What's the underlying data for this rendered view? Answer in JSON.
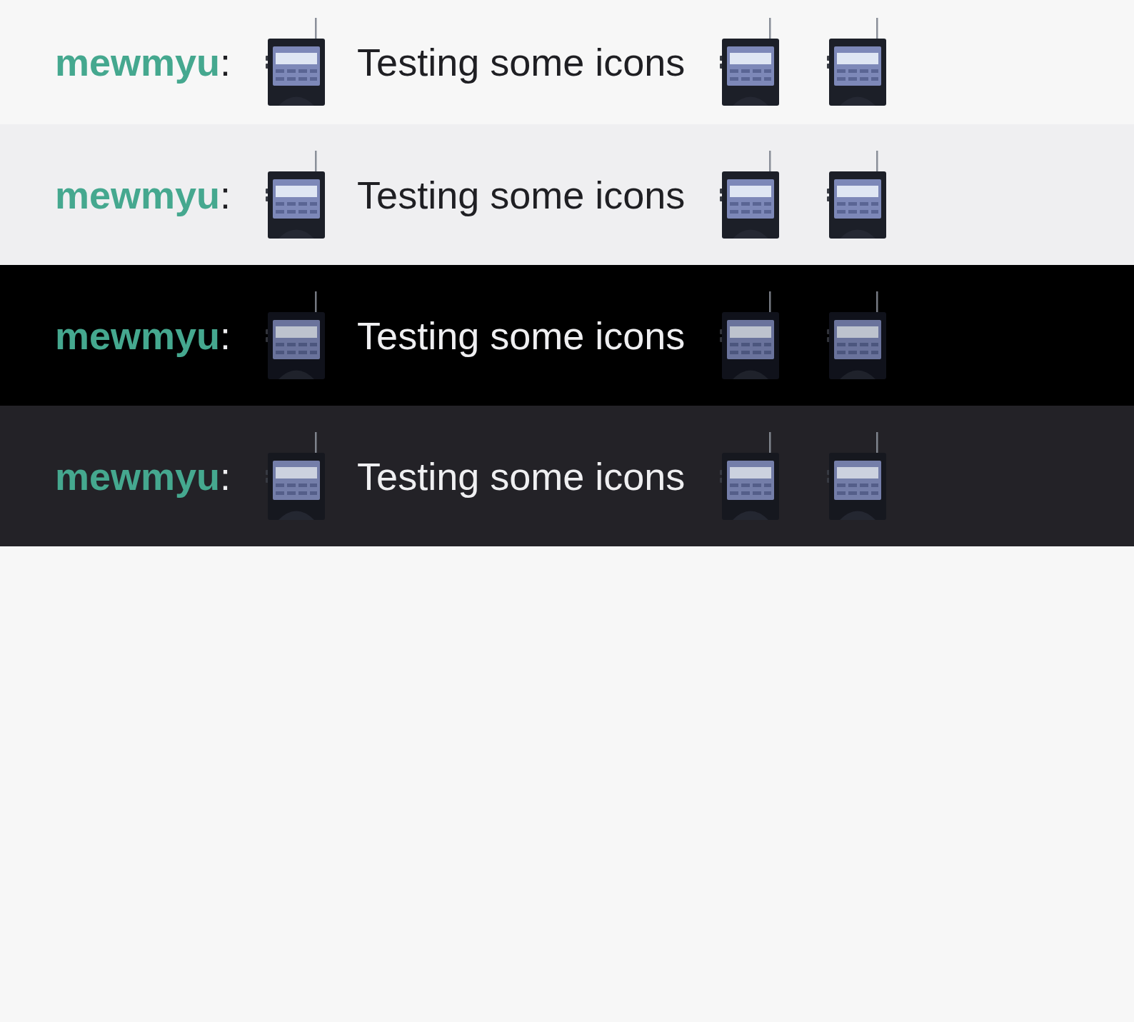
{
  "chat_lines": [
    {
      "kind": "light",
      "username": "mewmyu",
      "separator": ":",
      "message": [
        {
          "kind": "emote"
        },
        {
          "kind": "text",
          "text": "Testing some icons"
        },
        {
          "kind": "emote"
        },
        {
          "kind": "emote"
        }
      ]
    },
    {
      "kind": "light-alt",
      "username": "mewmyu",
      "separator": ":",
      "message": [
        {
          "kind": "emote"
        },
        {
          "kind": "text",
          "text": "Testing some icons"
        },
        {
          "kind": "emote"
        },
        {
          "kind": "emote"
        }
      ]
    },
    {
      "kind": "black",
      "username": "mewmyu",
      "separator": ":",
      "message": [
        {
          "kind": "emote"
        },
        {
          "kind": "text",
          "text": "Testing some icons"
        },
        {
          "kind": "emote"
        },
        {
          "kind": "emote"
        }
      ]
    },
    {
      "kind": "dark",
      "username": "mewmyu",
      "separator": ":",
      "message": [
        {
          "kind": "emote"
        },
        {
          "kind": "text",
          "text": "Testing some icons"
        },
        {
          "kind": "emote"
        },
        {
          "kind": "emote"
        }
      ]
    }
  ]
}
